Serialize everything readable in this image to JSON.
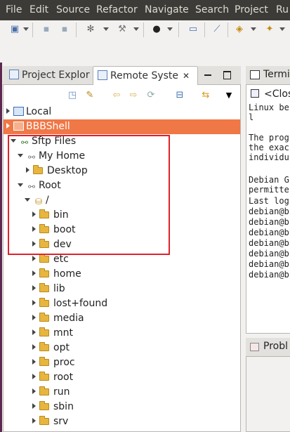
{
  "menu": [
    "File",
    "Edit",
    "Source",
    "Refactor",
    "Navigate",
    "Search",
    "Project",
    "Ru"
  ],
  "left_tabs": {
    "project_explorer": "Project Explor",
    "remote_systems": "Remote Syste",
    "close": "✕"
  },
  "view_menu": "▼",
  "tree": {
    "local": "Local",
    "bbbshell": "BBBShell",
    "sftp_files": "Sftp Files",
    "my_home": "My Home",
    "desktop": "Desktop",
    "root": "Root",
    "slash": "/",
    "dirs": [
      "bin",
      "boot",
      "dev",
      "etc",
      "home",
      "lib",
      "lost+found",
      "media",
      "mnt",
      "opt",
      "proc",
      "root",
      "run",
      "sbin",
      "srv"
    ]
  },
  "right_tab": {
    "terminal": "Termi",
    "close_tab": "<Clos"
  },
  "terminal_lines": [
    "Linux be",
    "l",
    "",
    "The prog",
    "the exac",
    "individu",
    "",
    "Debian G",
    "permitte",
    "Last log",
    "debian@b",
    "debian@b",
    "debian@b",
    "debian@b",
    "debian@b",
    "debian@b",
    "debian@b"
  ],
  "problems_tab": "Probl",
  "colors": {
    "selection": "#f07746",
    "highlight_box": "#e0202a",
    "menubar": "#3c3b37"
  },
  "icons": [
    "new-icon",
    "save-icon",
    "save-all-icon",
    "debug-icon",
    "build-icon",
    "run-icon",
    "console-icon",
    "pin-icon",
    "new-class-icon",
    "package-icon"
  ]
}
